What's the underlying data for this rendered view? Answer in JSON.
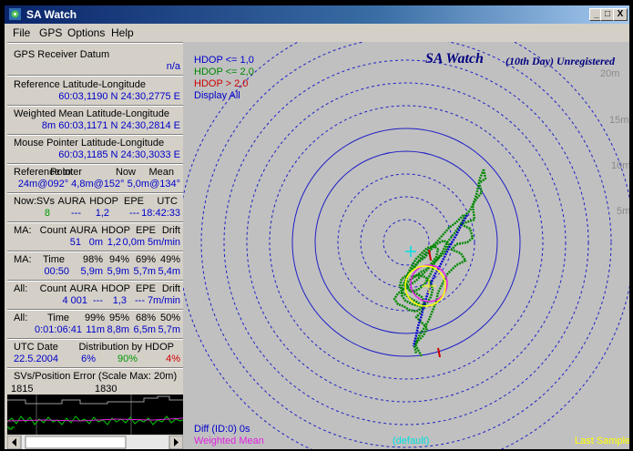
{
  "window": {
    "title": "SA Watch"
  },
  "window_buttons": [
    "_",
    "□",
    "X"
  ],
  "menu": [
    "File",
    "GPS",
    "Options",
    "Help"
  ],
  "datum": {
    "label": "GPS Receiver Datum",
    "value": "n/a"
  },
  "reference": {
    "label": "Reference Latitude-Longitude",
    "value": "60:03,1190 N  24:30,2775 E"
  },
  "weighted_mean": {
    "label": "Weighted Mean Latitude-Longitude",
    "value": "8m 60:03,1171 N  24:30,2814 E"
  },
  "mouse": {
    "label": "Mouse Pointer Latitude-Longitude",
    "value": "60:03,1185 N  24:30,3033 E"
  },
  "ref_to": {
    "label": "Reference to:",
    "h1": "Pointer",
    "h2": "Now",
    "h3": "Mean",
    "values": "24m@092°  4,8m@152°  5,0m@134°"
  },
  "now": {
    "label": "Now:",
    "h1": "SVs",
    "h2": "AURA",
    "h3": "HDOP",
    "h4": "EPE",
    "h5": "UTC",
    "v1": "8",
    "v2": "---",
    "v3": "1,2",
    "v4": "---",
    "v5": "18:42:33"
  },
  "ma_count": {
    "label": "MA:",
    "h1": "Count",
    "h2": "AURA",
    "h3": "HDOP",
    "h4": "EPE",
    "h5": "Drift",
    "v1": "51",
    "v2": "0m",
    "v3": "1,2",
    "v4": "0,0m",
    "v5": "5m/min"
  },
  "ma_time": {
    "label": "MA:",
    "h1": "Time",
    "h2": "98%",
    "h3": "94%",
    "h4": "69%",
    "h5": "49%",
    "v1": "00:50",
    "v2": "5,9m",
    "v3": "5,9m",
    "v4": "5,7m",
    "v5": "5,4m"
  },
  "all_count": {
    "label": "All:",
    "h1": "Count",
    "h2": "AURA",
    "h3": "HDOP",
    "h4": "EPE",
    "h5": "Drift",
    "v1": "4 001",
    "v2": "---",
    "v3": "1,3",
    "v4": "---",
    "v5": "7m/min"
  },
  "all_time": {
    "label": "All:",
    "h1": "Time",
    "h2": "99%",
    "h3": "95%",
    "h4": "68%",
    "h5": "50%",
    "v1": "0:01:06:41",
    "v2": "11m",
    "v3": "8,8m",
    "v4": "6,5m",
    "v5": "5,7m"
  },
  "utc": {
    "label": "UTC Date",
    "dist_label": "Distribution by HDOP",
    "date": "22.5.2004",
    "p1": "6%",
    "p2": "90%",
    "p3": "4%"
  },
  "svs_panel": {
    "label": "SVs/Position Error (Scale Max: 20m)",
    "t1": "1815",
    "t2": "1830"
  },
  "plot": {
    "title": "SA Watch",
    "subtitle": "(10th Day) Unregistered",
    "legend": [
      {
        "label": "HDOP <= 1,0",
        "color": "#0000cc"
      },
      {
        "label": "HDOP <= 2,0",
        "color": "#008800"
      },
      {
        "label": "HDOP  >  2,0",
        "color": "#cc0000"
      },
      {
        "label": "Display All",
        "color": "#0000cc"
      }
    ],
    "rings": [
      "20m",
      "15m",
      "10m",
      "5m"
    ],
    "diff": "Diff (ID:0) 0s",
    "weighted_mean": "Weighted Mean",
    "default": "(default)",
    "last_sample": "Last Sample"
  },
  "colors": {
    "title_start": "#0a246a",
    "title_end": "#a6caf0",
    "panel": "#d4d0c8",
    "plot_bg": "#c0c0c0",
    "value_blue": "#0000c8",
    "track_green": "#008800",
    "ring_blue": "#0000cc"
  }
}
